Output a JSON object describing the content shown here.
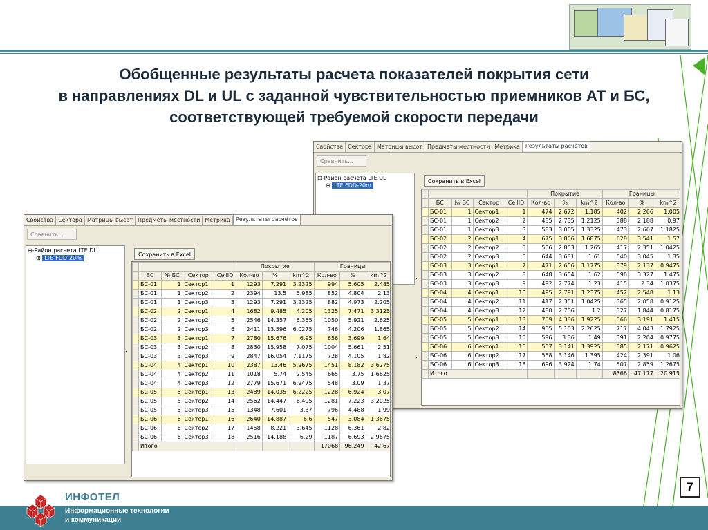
{
  "slide": {
    "title_lines": [
      "Обобщенные результаты расчета показателей покрытия сети",
      "в направлениях DL и UL с заданной чувствительностью приемников АТ и БС,",
      "соответствующей требуемой скорости передачи"
    ],
    "page_number": "7",
    "brand": "ИНФОТЕЛ",
    "tagline_lines": [
      "Информационные технологии",
      "и коммуникации"
    ],
    "colors": {
      "accent": "#3f7f92",
      "deco_green": "#4caf2a",
      "highlight_row": "#fef9c7"
    }
  },
  "app_tabs": [
    "Свойства",
    "Сектора",
    "Матрицы высот",
    "Предметы местности",
    "Метрика",
    "Результаты расчётов"
  ],
  "active_tab": "Результаты расчётов",
  "compare_button": "Сравнить...",
  "save_excel_button": "Сохранить в Excel",
  "tree_expand_glyph": "⊟",
  "tree_collapse_glyph": "⊞",
  "header": {
    "group_coverage": "Покрытие",
    "group_borders": "Границы",
    "columns": [
      "БС",
      "№ БС",
      "Сектор",
      "CellID",
      "Кол-во",
      "%",
      "km^2",
      "Кол-во",
      "%",
      "km^2"
    ]
  },
  "dl": {
    "tree_root": "Район расчета LTE DL",
    "tree_child": "LTE FDD-20m",
    "rows": [
      [
        "БС-01",
        "1",
        "Сектор1",
        "1",
        "1293",
        "7.291",
        "3.2325",
        "994",
        "5.605",
        "2.485"
      ],
      [
        "БС-01",
        "1",
        "Сектор2",
        "2",
        "2394",
        "13.5",
        "5.985",
        "852",
        "4.804",
        "2.13"
      ],
      [
        "БС-01",
        "1",
        "Сектор3",
        "3",
        "1293",
        "7.291",
        "3.2325",
        "882",
        "4.973",
        "2.205"
      ],
      [
        "БС-02",
        "2",
        "Сектор1",
        "4",
        "1682",
        "9.485",
        "4.205",
        "1325",
        "7.471",
        "3.3125"
      ],
      [
        "БС-02",
        "2",
        "Сектор2",
        "5",
        "2546",
        "14.357",
        "6.365",
        "1050",
        "5.921",
        "2.625"
      ],
      [
        "БС-02",
        "2",
        "Сектор3",
        "6",
        "2411",
        "13.596",
        "6.0275",
        "746",
        "4.206",
        "1.865"
      ],
      [
        "БС-03",
        "3",
        "Сектор1",
        "7",
        "2780",
        "15.676",
        "6.95",
        "656",
        "3.699",
        "1.64"
      ],
      [
        "БС-03",
        "3",
        "Сектор2",
        "8",
        "2830",
        "15.958",
        "7.075",
        "1004",
        "5.661",
        "2.51"
      ],
      [
        "БС-03",
        "3",
        "Сектор3",
        "9",
        "2847",
        "16.054",
        "7.1175",
        "728",
        "4.105",
        "1.82"
      ],
      [
        "БС-04",
        "4",
        "Сектор1",
        "10",
        "2387",
        "13.46",
        "5.9675",
        "1451",
        "8.182",
        "3.6275"
      ],
      [
        "БС-04",
        "4",
        "Сектор2",
        "11",
        "1018",
        "5.74",
        "2.545",
        "665",
        "3.75",
        "1.6625"
      ],
      [
        "БС-04",
        "4",
        "Сектор3",
        "12",
        "2779",
        "15.671",
        "6.9475",
        "548",
        "3.09",
        "1.37"
      ],
      [
        "БС-05",
        "5",
        "Сектор1",
        "13",
        "2489",
        "14.035",
        "6.2225",
        "1228",
        "6.924",
        "3.07"
      ],
      [
        "БС-05",
        "5",
        "Сектор2",
        "14",
        "2562",
        "14.447",
        "6.405",
        "1281",
        "7.223",
        "3.2025"
      ],
      [
        "БС-05",
        "5",
        "Сектор3",
        "15",
        "1348",
        "7.601",
        "3.37",
        "796",
        "4.488",
        "1.99"
      ],
      [
        "БС-06",
        "6",
        "Сектор1",
        "16",
        "2640",
        "14.887",
        "6.6",
        "547",
        "3.084",
        "1.3675"
      ],
      [
        "БС-06",
        "6",
        "Сектор2",
        "17",
        "1458",
        "8.221",
        "3.645",
        "1128",
        "6.361",
        "2.82"
      ],
      [
        "БС-06",
        "6",
        "Сектор3",
        "18",
        "2516",
        "14.188",
        "6.29",
        "1187",
        "6.693",
        "2.9675"
      ]
    ],
    "total_label": "Итого",
    "totals": [
      "17068",
      "96.249",
      "42.67"
    ]
  },
  "ul": {
    "tree_root": "Район расчета LTE UL",
    "tree_child": "LTE FDD-20m",
    "rows": [
      [
        "БС-01",
        "1",
        "Сектор1",
        "1",
        "474",
        "2.672",
        "1.185",
        "402",
        "2.266",
        "1.005"
      ],
      [
        "БС-01",
        "1",
        "Сектор2",
        "2",
        "485",
        "2.735",
        "1.2125",
        "388",
        "2.188",
        "0.97"
      ],
      [
        "БС-01",
        "1",
        "Сектор3",
        "3",
        "533",
        "3.005",
        "1.3325",
        "473",
        "2.667",
        "1.1825"
      ],
      [
        "БС-02",
        "2",
        "Сектор1",
        "4",
        "675",
        "3.806",
        "1.6875",
        "628",
        "3.541",
        "1.57"
      ],
      [
        "БС-02",
        "2",
        "Сектор2",
        "5",
        "506",
        "2.853",
        "1.265",
        "417",
        "2.351",
        "1.0425"
      ],
      [
        "БС-02",
        "2",
        "Сектор3",
        "6",
        "644",
        "3.631",
        "1.61",
        "540",
        "3.045",
        "1.35"
      ],
      [
        "БС-03",
        "3",
        "Сектор1",
        "7",
        "471",
        "2.656",
        "1.1775",
        "379",
        "2.137",
        "0.9475"
      ],
      [
        "БС-03",
        "3",
        "Сектор2",
        "8",
        "648",
        "3.654",
        "1.62",
        "590",
        "3.327",
        "1.475"
      ],
      [
        "БС-03",
        "3",
        "Сектор3",
        "9",
        "492",
        "2.774",
        "1.23",
        "415",
        "2.34",
        "1.0375"
      ],
      [
        "БС-04",
        "4",
        "Сектор1",
        "10",
        "495",
        "2.791",
        "1.2375",
        "452",
        "2.548",
        "1.13"
      ],
      [
        "БС-04",
        "4",
        "Сектор2",
        "11",
        "417",
        "2.351",
        "1.0425",
        "365",
        "2.058",
        "0.9125"
      ],
      [
        "БС-04",
        "4",
        "Сектор3",
        "12",
        "480",
        "2.706",
        "1.2",
        "327",
        "1.844",
        "0.8175"
      ],
      [
        "БС-05",
        "5",
        "Сектор1",
        "13",
        "769",
        "4.336",
        "1.9225",
        "566",
        "3.191",
        "1.415"
      ],
      [
        "БС-05",
        "5",
        "Сектор2",
        "14",
        "905",
        "5.103",
        "2.2625",
        "717",
        "4.043",
        "1.7925"
      ],
      [
        "БС-05",
        "5",
        "Сектор3",
        "15",
        "596",
        "3.36",
        "1.49",
        "391",
        "2.204",
        "0.9775"
      ],
      [
        "БС-06",
        "6",
        "Сектор1",
        "16",
        "557",
        "3.141",
        "1.3925",
        "385",
        "2.171",
        "0.9625"
      ],
      [
        "БС-06",
        "6",
        "Сектор2",
        "17",
        "558",
        "3.146",
        "1.395",
        "424",
        "2.391",
        "1.06"
      ],
      [
        "БС-06",
        "6",
        "Сектор3",
        "18",
        "696",
        "3.924",
        "1.74",
        "507",
        "2.859",
        "1.2675"
      ]
    ],
    "total_label": "Итого",
    "totals": [
      "8366",
      "47.177",
      "20.915"
    ]
  }
}
